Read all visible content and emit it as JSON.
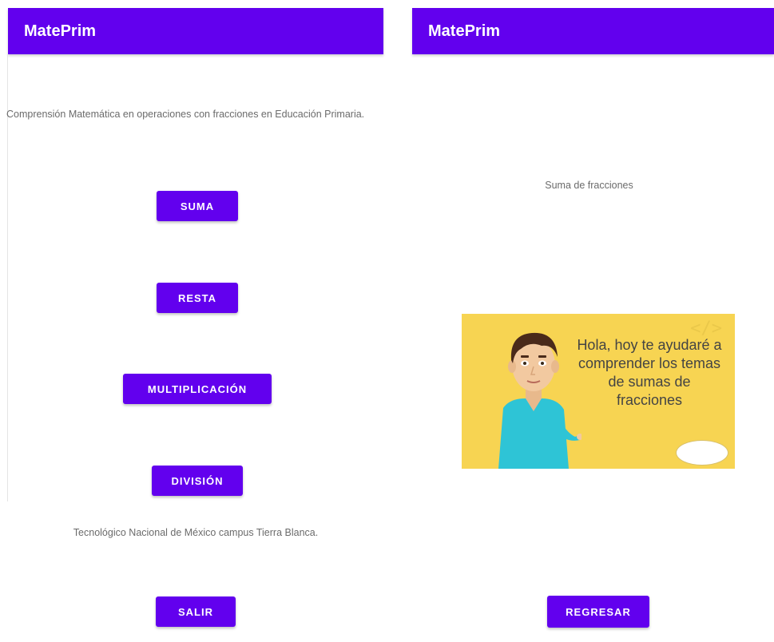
{
  "left_screen": {
    "app_title": "MatePrim",
    "description": "Comprensión Matemática en operaciones con fracciones en Educación Primaria.",
    "buttons": {
      "suma": "SUMA",
      "resta": "RESTA",
      "multiplicacion": "MULTIPLICACIÓN",
      "division": "DIVISIÓN",
      "salir": "SALIR"
    },
    "footer": "Tecnológico Nacional de México campus Tierra Blanca."
  },
  "right_screen": {
    "app_title": "MatePrim",
    "subtitle": "Suma de fracciones",
    "video": {
      "speech_text": "Hola, hoy te ayudaré a comprender los temas de sumas de fracciones",
      "deco_glyph": "</>",
      "background_color": "#f7d452"
    },
    "buttons": {
      "regresar": "REGRESAR"
    }
  },
  "colors": {
    "primary": "#6200ee",
    "text_secondary": "#6b6b6b",
    "shirt": "#2ec4d6",
    "hair": "#4a2a1a",
    "skin": "#f2c9a0"
  }
}
